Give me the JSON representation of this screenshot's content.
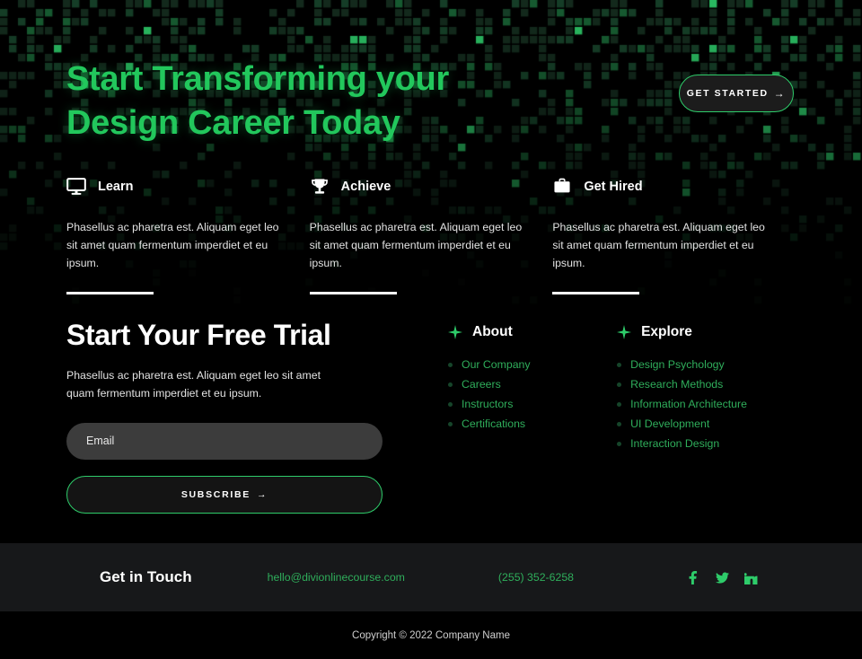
{
  "hero": {
    "title_line1": "Start Transforming your",
    "title_line2": "Design Career Today",
    "cta_label": "GET STARTED",
    "cta_arrow": "→",
    "accent_color": "#22c75c"
  },
  "features": [
    {
      "icon": "monitor-icon",
      "name": "Learn",
      "text": "Phasellus ac pharetra est. Aliquam eget leo sit amet quam fermentum imperdiet et eu ipsum."
    },
    {
      "icon": "trophy-icon",
      "name": "Achieve",
      "text": "Phasellus ac pharetra est. Aliquam eget leo sit amet quam fermentum imperdiet et eu ipsum."
    },
    {
      "icon": "briefcase-icon",
      "name": "Get Hired",
      "text": "Phasellus ac pharetra est. Aliquam eget leo sit amet quam fermentum imperdiet et eu ipsum."
    }
  ],
  "trial": {
    "title": "Start Your Free Trial",
    "text": "Phasellus ac pharetra est. Aliquam eget leo sit amet quam fermentum imperdiet et eu ipsum.",
    "email_placeholder": "Email",
    "email_value": "",
    "subscribe_label": "SUBSCRIBE",
    "subscribe_arrow": "→"
  },
  "about": {
    "icon": "sparkle-icon",
    "title": "About",
    "links": [
      "Our Company",
      "Careers",
      "Instructors",
      "Certifications"
    ]
  },
  "explore": {
    "icon": "sparkle-icon",
    "title": "Explore",
    "links": [
      "Design Psychology",
      "Research Methods",
      "Information Architecture",
      "UI Development",
      "Interaction Design"
    ]
  },
  "contact": {
    "title": "Get in Touch",
    "email": "hello@divionlinecourse.com",
    "phone": "(255) 352-6258",
    "socials": [
      "facebook-icon",
      "twitter-icon",
      "linkedin-icon"
    ]
  },
  "copyright": "Copyright © 2022 Company Name",
  "colors": {
    "accent_green": "#22c75c",
    "link_green": "#2fae5b",
    "bar_background": "#17181a",
    "page_background": "#000000"
  }
}
